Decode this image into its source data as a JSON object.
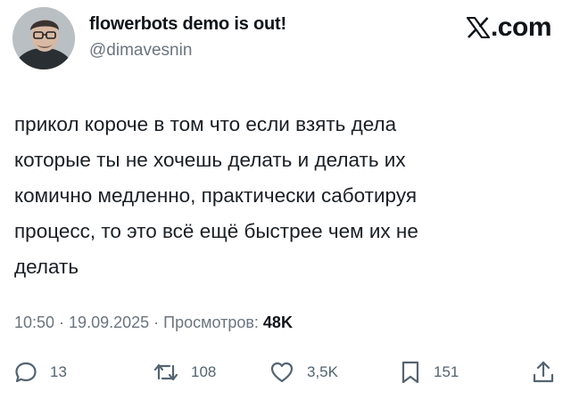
{
  "author": {
    "name": "flowerbots demo is out!",
    "handle": "@dimavesnin"
  },
  "brand": {
    "label": ".com",
    "icon": "x-logo-icon"
  },
  "tweet": {
    "lines": [
      "прикол короче в том что если взять дела",
      "которые ты не хочешь делать и делать их",
      "комично медленно, практически саботируя",
      "процесс, то это всё ещё быстрее чем их не",
      "делать"
    ]
  },
  "meta": {
    "time": "10:50",
    "sep1": " · ",
    "date": "19.09.2025",
    "sep2": " · ",
    "views_label": "Просмотров: ",
    "views_count": "48K"
  },
  "actions": {
    "replies": "13",
    "reposts": "108",
    "likes": "3,5K",
    "bookmarks": "151"
  },
  "colors": {
    "text": "#0f1419",
    "muted": "#6b7580",
    "icon": "#536471"
  }
}
